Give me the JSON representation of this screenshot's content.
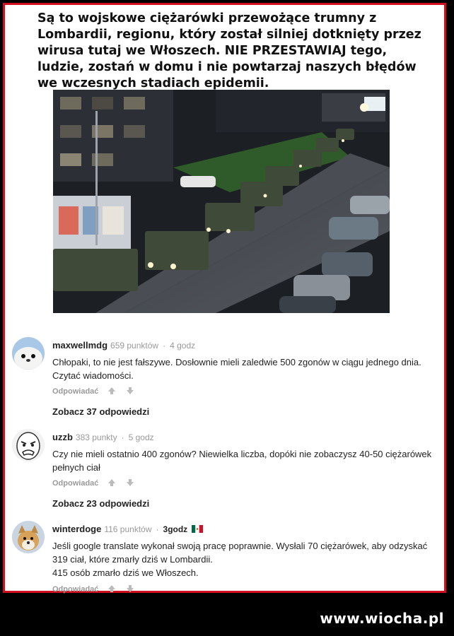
{
  "headline": "Są to wojskowe ciężarówki przewożące trumny z Lombardii, regionu, który został silniej dotknięty przez wirusa tutaj we Włoszech. NIE PRZESTAWIAJ tego, ludzie, zostań w domu i nie powtarzaj naszych błędów we wczesnych stadiach epidemii.",
  "comments": [
    {
      "user": "maxwellmdg",
      "points": "659 punktów",
      "time": "4 godz",
      "text": "Chłopaki, to nie jest fałszywe. Dosłownie mieli zaledwie 500 zgonów w ciągu jednego dnia. Czytać wiadomości.",
      "reply_label": "Odpowiadać",
      "see_replies": "Zobacz 37 odpowiedzi",
      "avatar": "seal-avatar"
    },
    {
      "user": "uzzb",
      "points": "383 punkty",
      "time": "5 godz",
      "text": "Czy nie mieli ostatnio 400 zgonów? Niewielka liczba, dopóki nie zobaczysz 40-50 ciężarówek pełnych ciał",
      "reply_label": "Odpowiadać",
      "see_replies": "Zobacz 23 odpowiedzi",
      "avatar": "rage-face-avatar"
    },
    {
      "user": "winterdoge",
      "points": "116 punktów",
      "time": "3godz",
      "flag": "mexico-flag-icon",
      "text": "Jeśli google translate wykonał swoją pracę poprawnie. Wysłali 70 ciężarówek, aby odzyskać 319 ciał, które zmarły dziś w Lombardii.",
      "text2": "415 osób zmarło dziś we Włoszech.",
      "reply_label": "Odpowiadać",
      "avatar": "doge-avatar"
    }
  ],
  "watermark": "www.wiocha.pl",
  "colors": {
    "frame": "#d0101e",
    "background": "#000000"
  }
}
